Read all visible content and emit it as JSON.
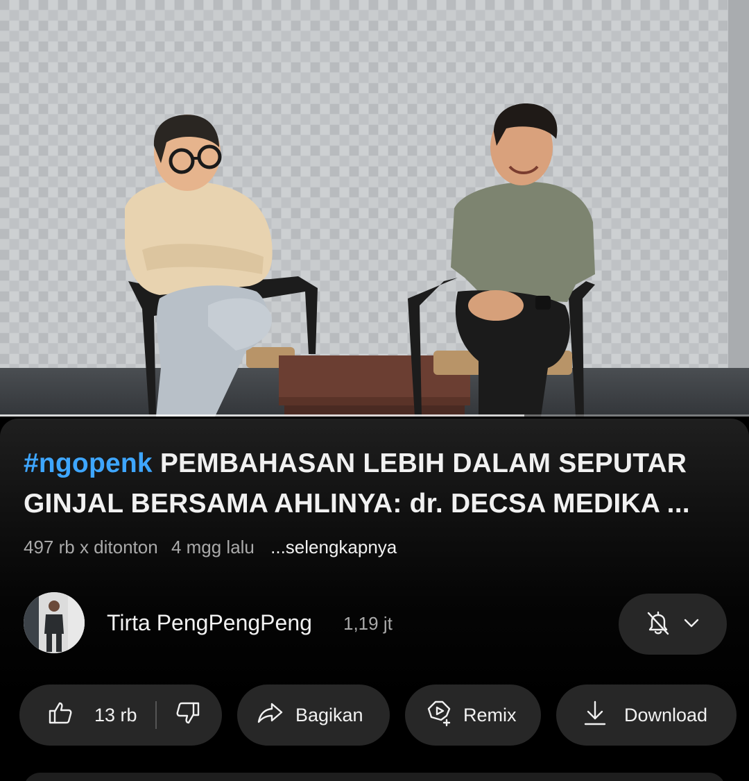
{
  "video": {
    "progress_percent": 0,
    "buffered_percent": 70
  },
  "title": {
    "hashtag": "#ngopenk",
    "text": " PEMBAHASAN LEBIH DALAM SEPUTAR GINJAL BERSAMA AHLINYA: dr. DECSA MEDIKA ..."
  },
  "meta": {
    "views": "497 rb x ditonton",
    "age": "4 mgg lalu",
    "more": "...selengkapnya"
  },
  "channel": {
    "name": "Tirta PengPengPeng",
    "subscribers": "1,19 jt",
    "notification_icon": "bell-off-icon",
    "dropdown_icon": "chevron-down-icon"
  },
  "actions": {
    "like_count": "13 rb",
    "share_label": "Bagikan",
    "remix_label": "Remix",
    "download_label": "Download"
  },
  "colors": {
    "accent_link": "#3ea6ff",
    "pill_bg": "#272727",
    "text_secondary": "#aaaaaa"
  }
}
